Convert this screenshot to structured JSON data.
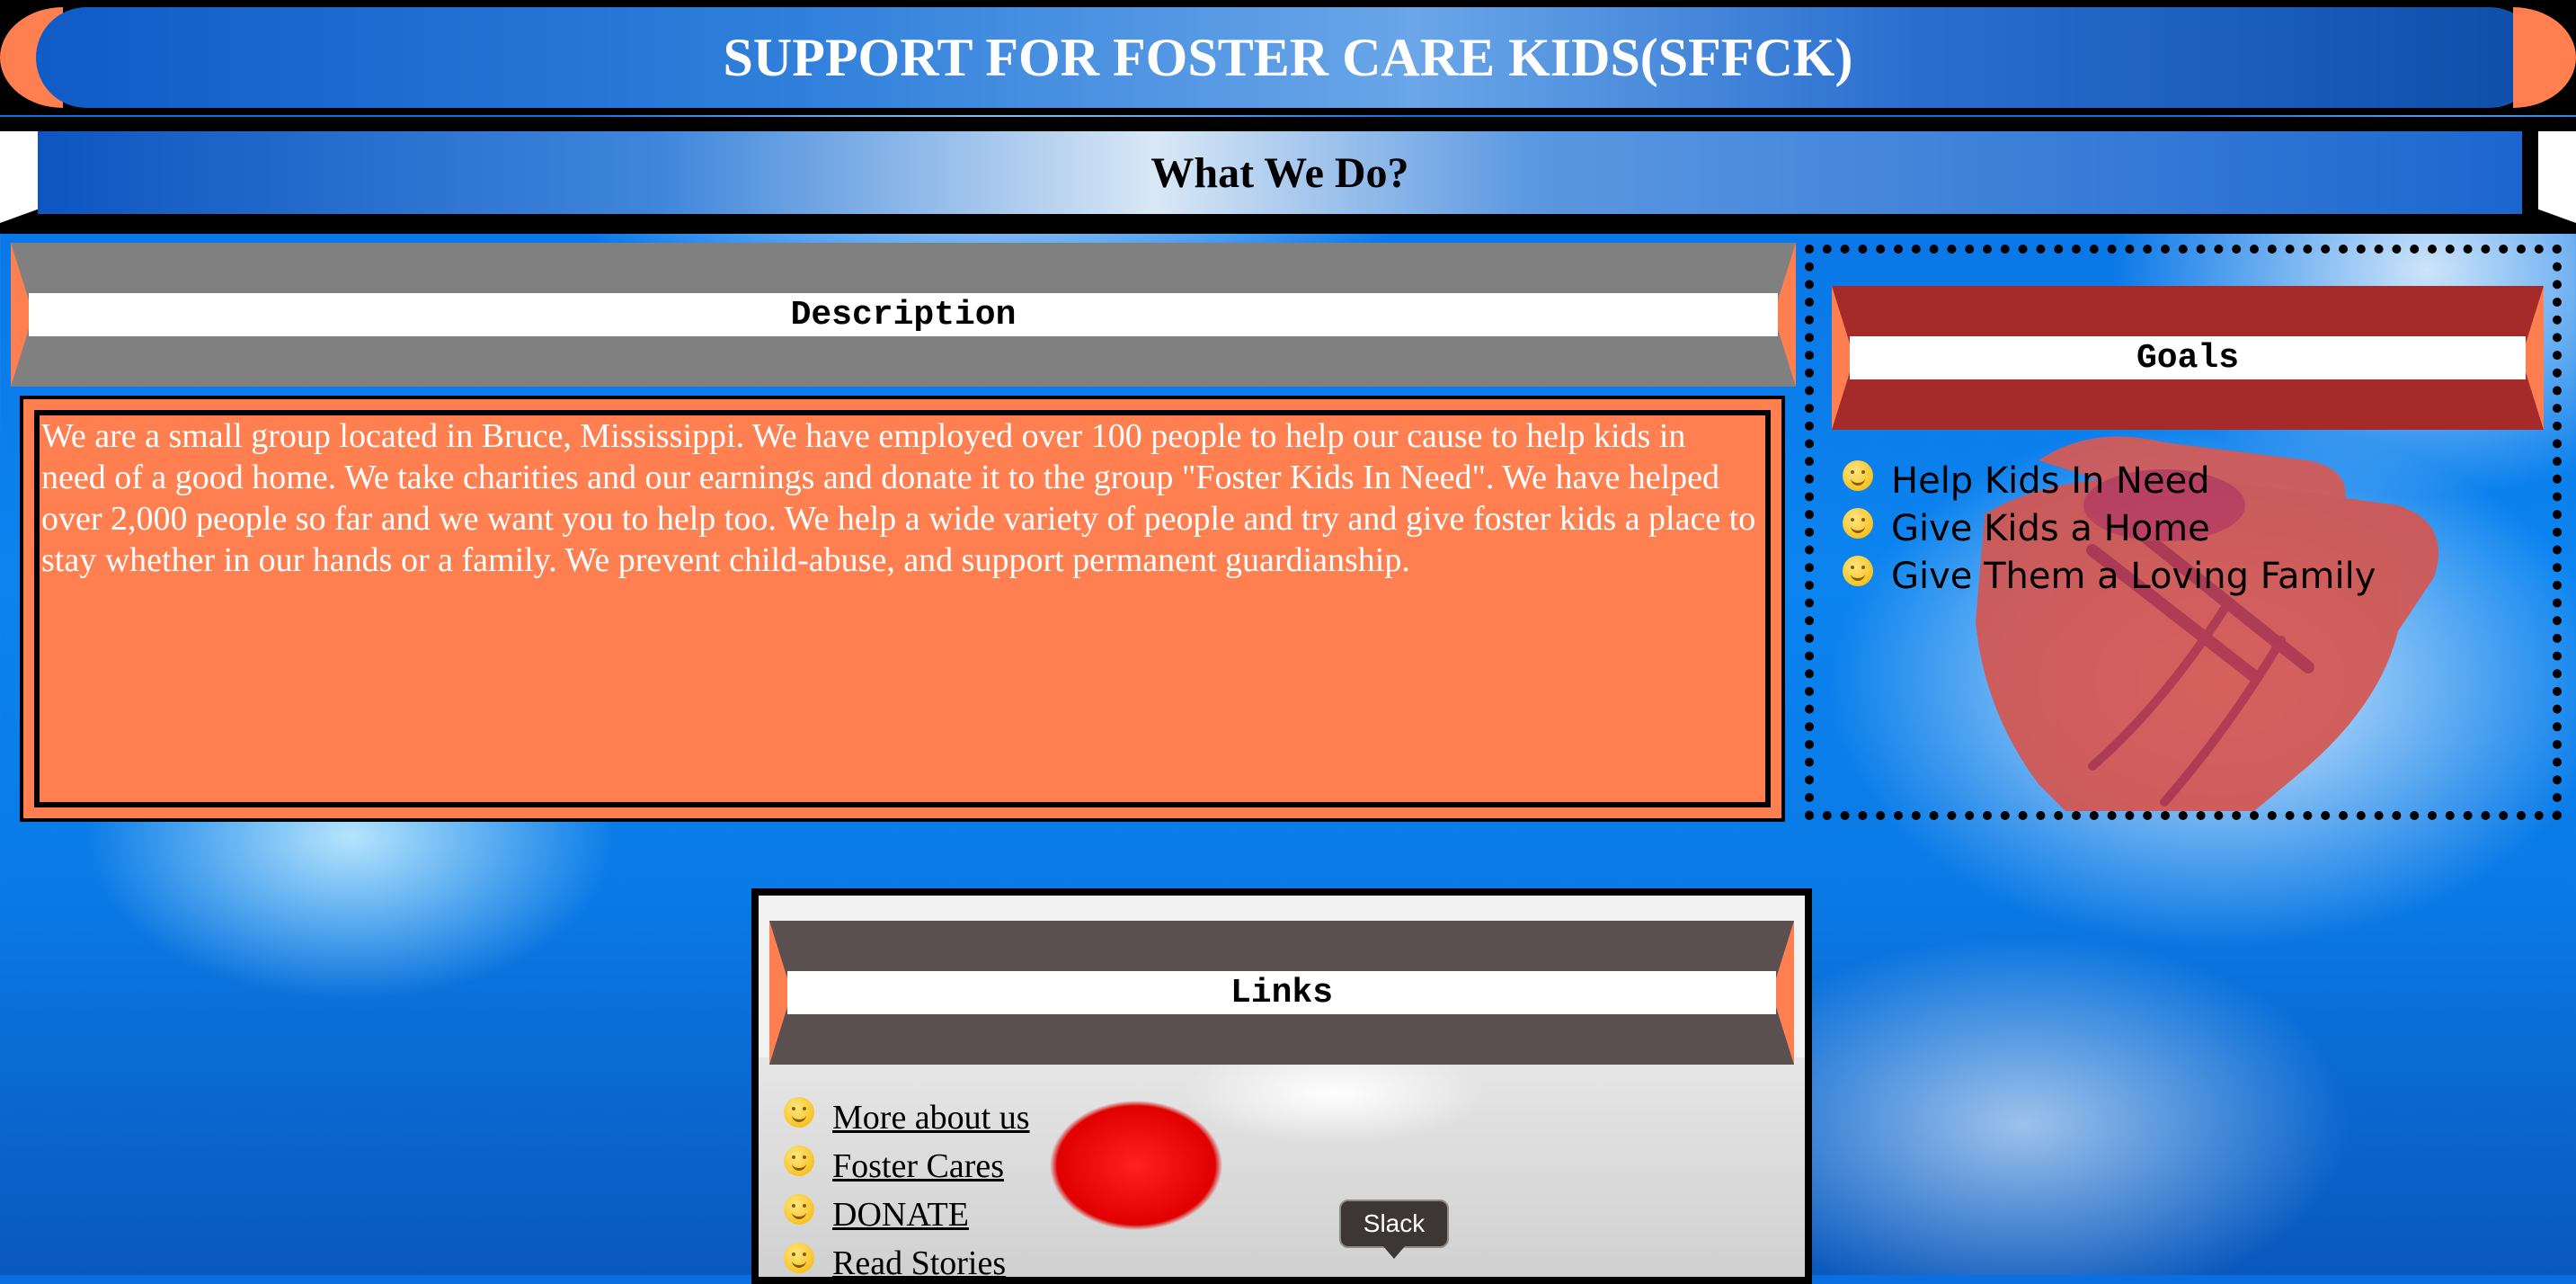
{
  "header": {
    "title": "SUPPORT FOR FOSTER CARE KIDS(SFFCK)",
    "subtitle": "What We Do?"
  },
  "description": {
    "heading": "Description",
    "body": "We are a small group located in Bruce, Mississippi. We have employed over 100 people to help our cause to help kids in need of a good home. We take charities and our earnings and donate it to the group \"Foster Kids In Need\". We have helped over 2,000 people so far and we want you to help too. We help a wide variety of people and try and give foster kids a place to stay whether in our hands or a family. We prevent child-abuse, and support permanent guardianship."
  },
  "goals": {
    "heading": "Goals",
    "items": [
      "Help Kids In Need",
      "Give Kids a Home",
      "Give Them a Loving Family"
    ]
  },
  "links": {
    "heading": "Links",
    "items": [
      "More about us",
      "Foster Cares",
      "DONATE",
      "Read Stories"
    ]
  },
  "tooltip": {
    "text": "Slack"
  },
  "colors": {
    "accent": "#ff7f50",
    "description_header": "#808080",
    "goals_header": "#a52a2a",
    "links_header": "#5b5050"
  }
}
